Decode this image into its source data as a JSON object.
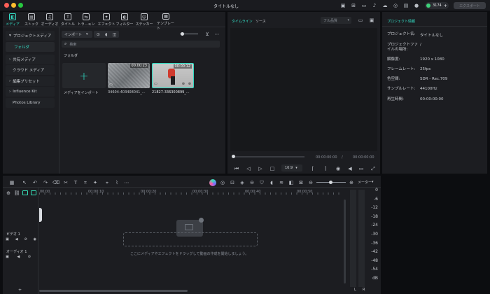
{
  "window": {
    "title": "タイトルなし"
  },
  "titlebar": {
    "credits": "3174",
    "export_label": "エクスポート"
  },
  "toolbar": {
    "tabs": [
      {
        "label": "メディア",
        "icon": "media-icon"
      },
      {
        "label": "ストック",
        "icon": "stock-icon"
      },
      {
        "label": "オーディオ",
        "icon": "audio-icon"
      },
      {
        "label": "タイトル",
        "icon": "title-icon"
      },
      {
        "label": "トラ...ョン",
        "icon": "transition-icon"
      },
      {
        "label": "エフェクト",
        "icon": "effect-icon"
      },
      {
        "label": "フィルター",
        "icon": "filter-icon"
      },
      {
        "label": "ステッカー",
        "icon": "sticker-icon"
      },
      {
        "label": "テンプレート",
        "icon": "template-icon"
      }
    ]
  },
  "sidebar": {
    "items": [
      {
        "label": "プロジェクトメディア",
        "arrow": "▾"
      },
      {
        "label": "フォルダ",
        "arrow": ""
      },
      {
        "label": "共有メディア",
        "arrow": "›"
      },
      {
        "label": "クラウド メディア",
        "arrow": ""
      },
      {
        "label": "編集プリセット",
        "arrow": "›"
      },
      {
        "label": "Influence Kit",
        "arrow": "›"
      },
      {
        "label": "Photos Library",
        "arrow": ""
      }
    ]
  },
  "media": {
    "import_label": "インポート",
    "search_placeholder": "検索",
    "folder_label": "フォルダ",
    "import_tile_label": "メディアをインポート",
    "clips": [
      {
        "name": "34604-403408041_...",
        "duration": "00:00:23"
      },
      {
        "name": "21827-336300899_...",
        "duration": "00:00:12"
      }
    ]
  },
  "player": {
    "tab_timeline": "タイムライン",
    "tab_source": "ソース",
    "quality": "フル品質",
    "time_current": "00:00:00:00",
    "time_total": "00:00:00:00",
    "aspect": "16:9"
  },
  "project_info": {
    "header": "プロジェクト情報",
    "rows": [
      {
        "key": "プロジェクト名:",
        "value": "タイトルなし"
      },
      {
        "key": "プロジェクトファイルの場所:",
        "value": "/"
      },
      {
        "key": "解像度:",
        "value": "1920 x 1080"
      },
      {
        "key": "フレームレート:",
        "value": "25fps"
      },
      {
        "key": "色空間:",
        "value": "SDR - Rec.709"
      },
      {
        "key": "サンプルレート:",
        "value": "44100Hz"
      },
      {
        "key": "再生時間:",
        "value": "00:00:00:00"
      }
    ]
  },
  "timeline": {
    "meter_label": "メーター",
    "ruler": [
      "00:00",
      "00:00:10",
      "00:00:20",
      "00:00:30",
      "00:00:40",
      "00:00:50"
    ],
    "tracks": [
      {
        "label": "ビデオ 1"
      },
      {
        "label": "オーディオ 1"
      }
    ],
    "drop_hint": "ここにメディアやエフェクトをドラッグして動画の作成を開始しましょう。",
    "meter_scale": [
      "0",
      "-6",
      "-12",
      "-18",
      "-24",
      "-30",
      "-36",
      "-42",
      "-48",
      "-54",
      "dB"
    ],
    "meter_channels": [
      "L",
      "R"
    ]
  }
}
